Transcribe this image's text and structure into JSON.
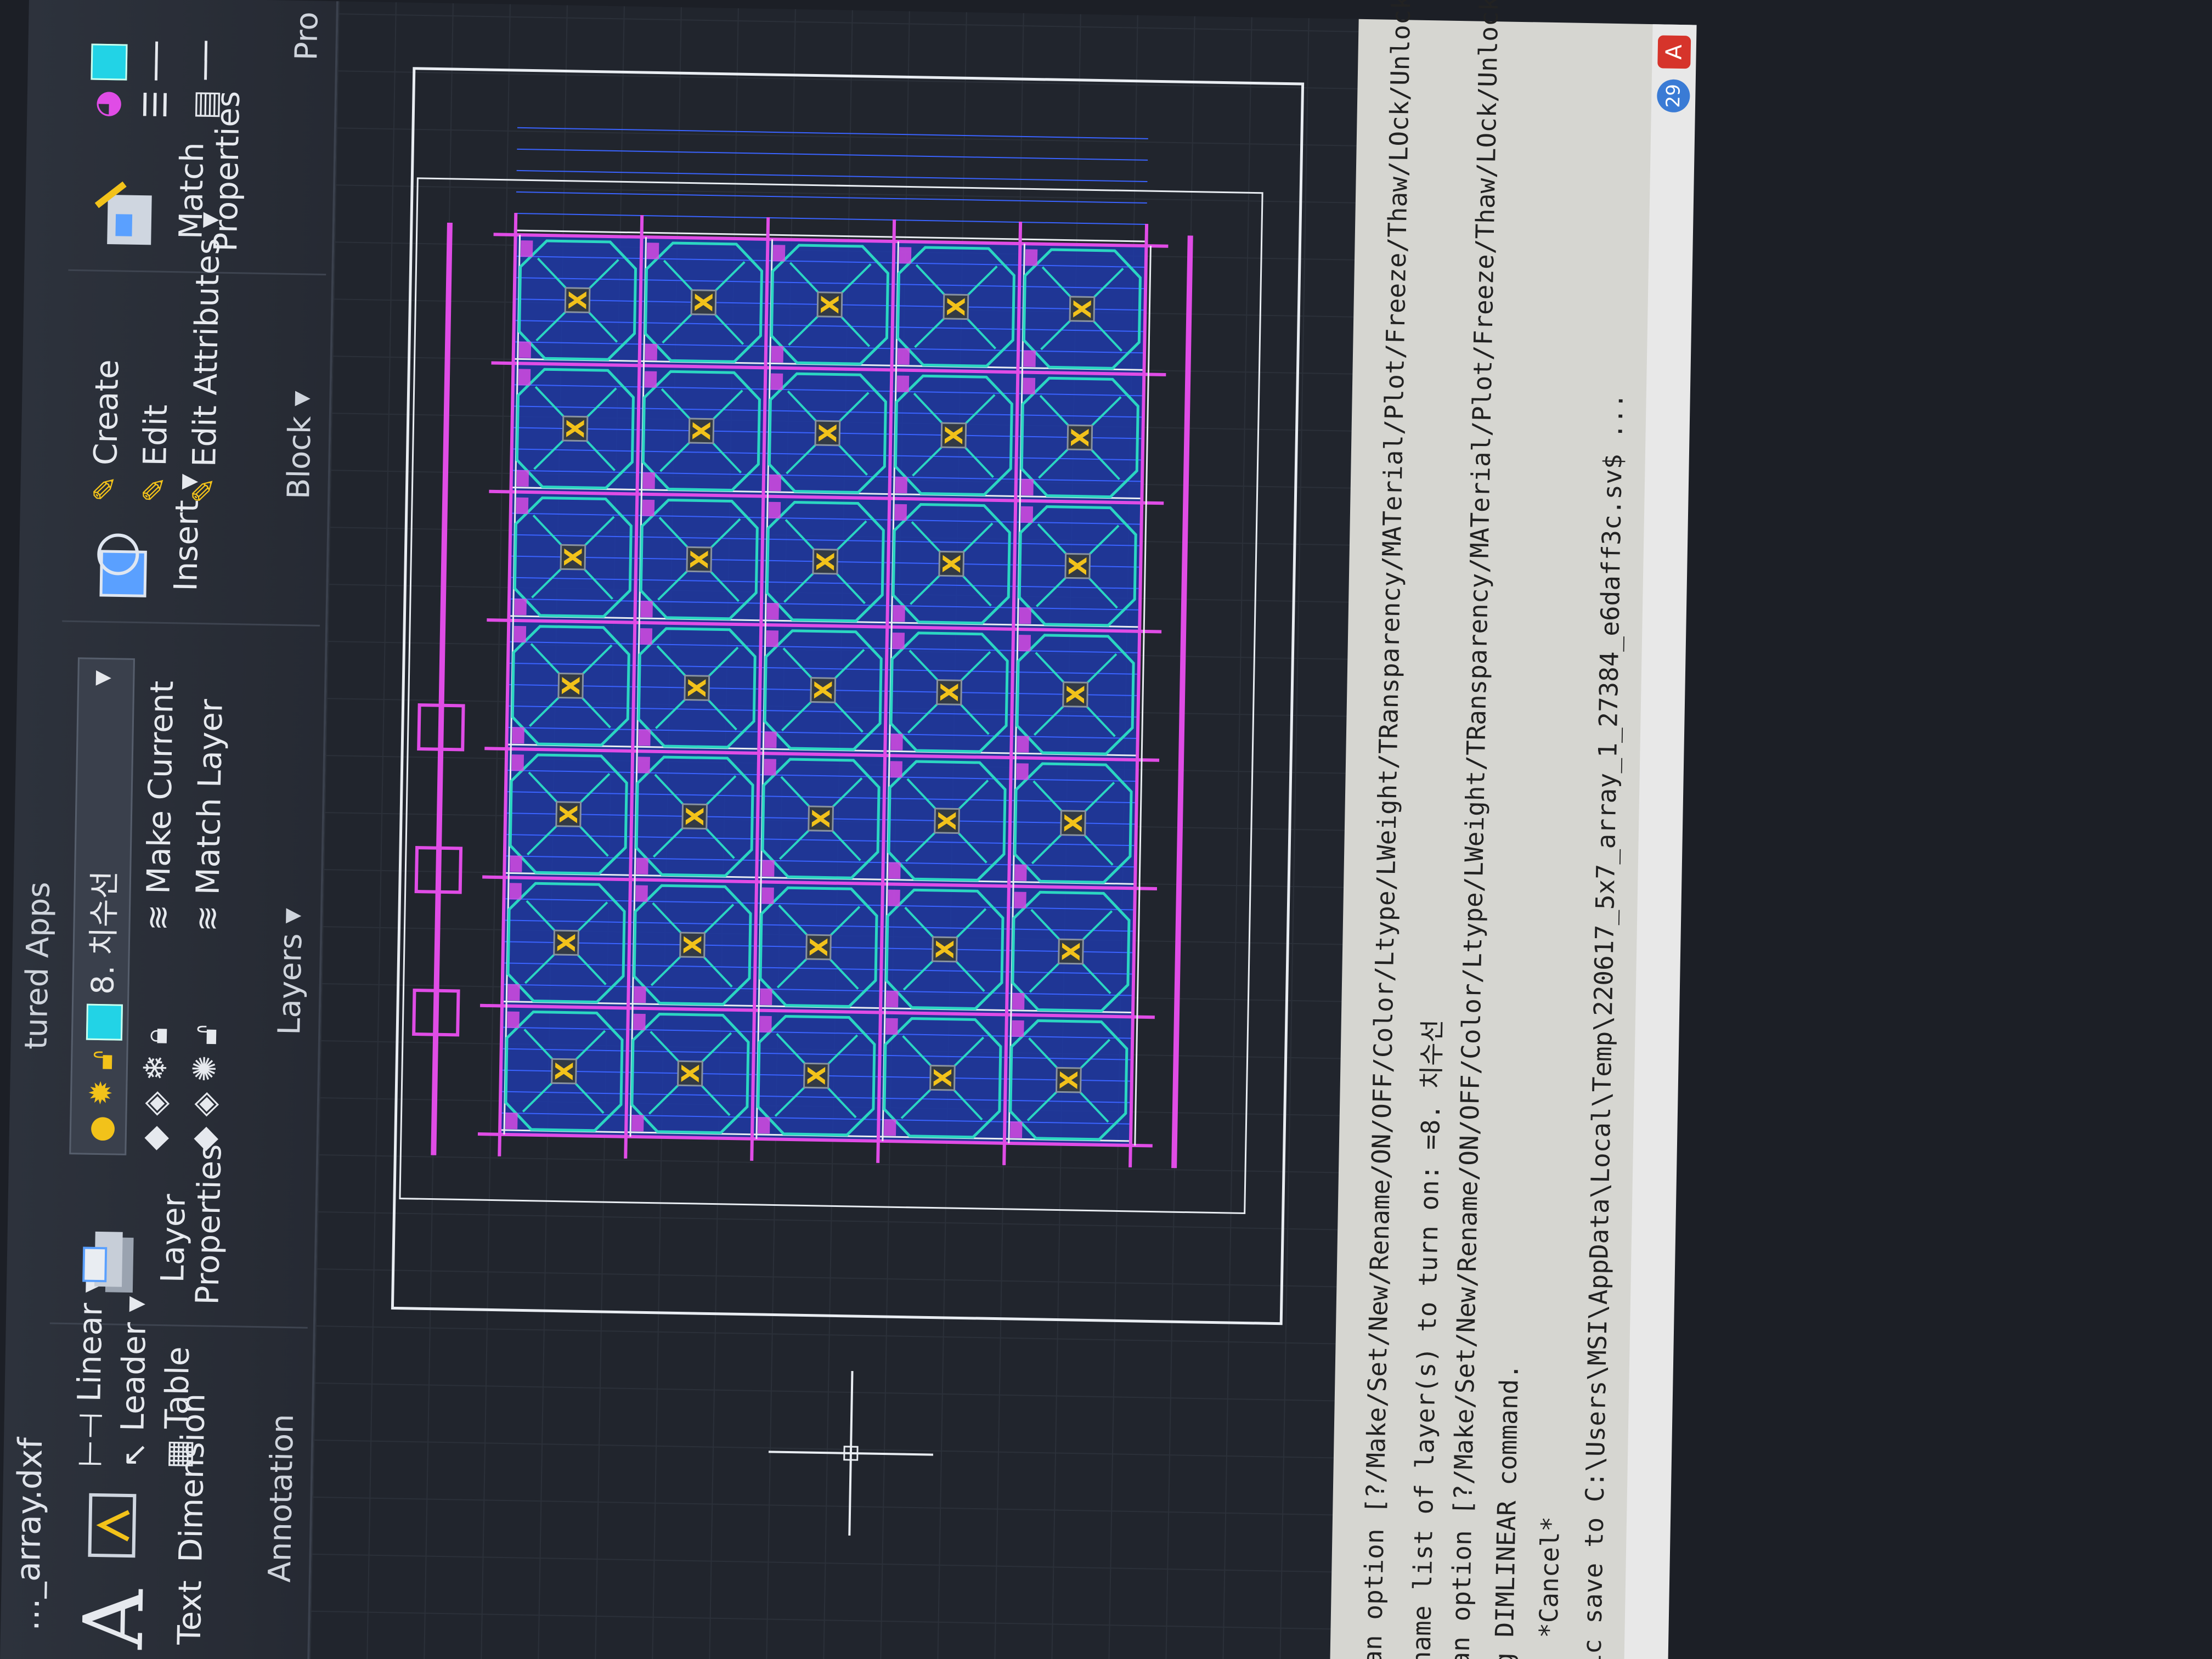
{
  "file_title": "…_array.dxf",
  "ribbon": {
    "featured_apps_label": "tured Apps",
    "annotation": {
      "text_label": "Text",
      "dimension_label": "Dimension",
      "linear_label": "Linear",
      "leader_label": "Leader",
      "table_label": "Table",
      "panel_label": "Annotation"
    },
    "layers": {
      "layer_properties_label": "Layer Properties",
      "current_layer": "8. 치수선",
      "make_current_label": "Make Current",
      "match_layer_label": "Match Layer",
      "panel_label": "Layers"
    },
    "block": {
      "insert_label": "Insert",
      "create_label": "Create",
      "edit_label": "Edit",
      "edit_attributes_label": "Edit Attributes",
      "panel_label": "Block"
    },
    "properties": {
      "match_properties_label": "Match Properties",
      "panel_label_partial": "Pro"
    }
  },
  "drawing": {
    "columns": 5,
    "rows": 7,
    "colors": {
      "bay_fill": "#1e3aa8",
      "grid_line": "#3a63ff",
      "beam_magenta": "#e04ce6",
      "diagonal_cyan": "#2bd6c2",
      "marker_yellow": "#f2c21a",
      "frame_white": "#e9edf2"
    }
  },
  "command_history": [
    "an option [?/Make/Set/New/Rename/ON/OFF/Color/Ltype/LWeight/TRansparency/MATerial/Plot/Freeze/Thaw/LOck/Unlock/",
    "name list of layer(s) to turn on: =8. 치수선",
    "an option [?/Make/Set/New/Rename/ON/OFF/Color/Ltype/LWeight/TRansparency/MATerial/Plot/Freeze/Thaw/LOck/Unlock/",
    "g DIMLINEAR command.",
    ": *Cancel*",
    "ic save to C:\\Users\\MSI\\AppData\\Local\\Temp\\220617_5x7_array_1_27384_e6daff3c.sv$ ..."
  ],
  "taskbar": {
    "badge_count": "29"
  }
}
